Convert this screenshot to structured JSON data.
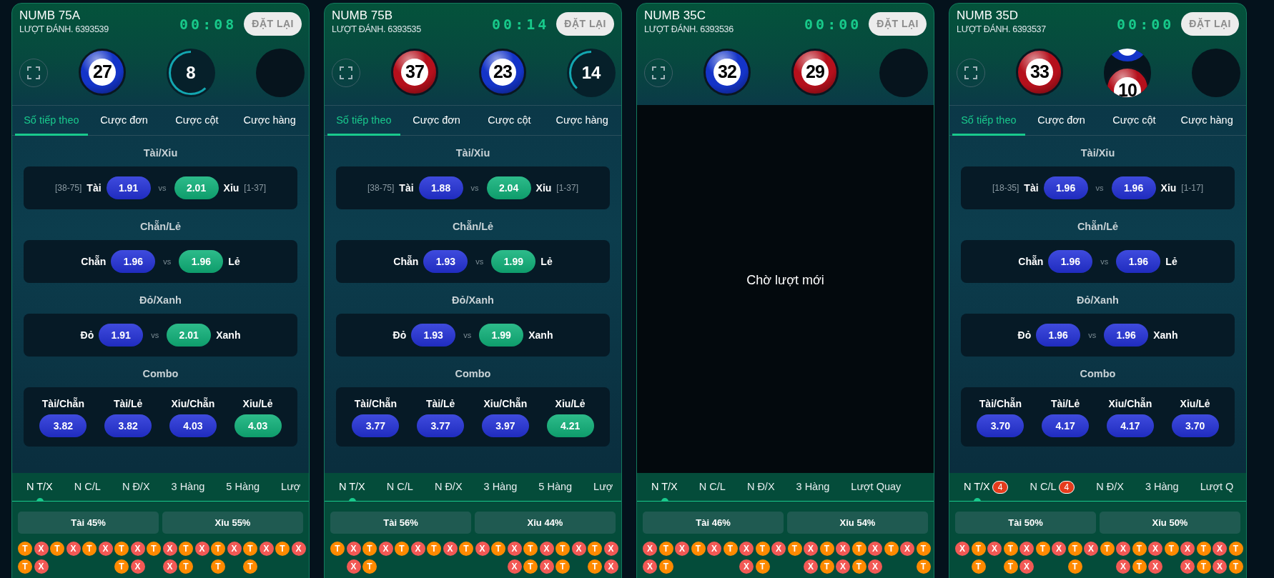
{
  "panels": [
    {
      "title": "NUMB 75A",
      "round": "LƯỢT ĐÁNH. 6393539",
      "timer": "00:08",
      "reset": "ĐẶT LẠI",
      "slots": [
        {
          "kind": "ball",
          "number": "27",
          "color": "#1434c8"
        },
        {
          "kind": "countdown",
          "number": "8",
          "level": 0.62
        },
        {
          "kind": "empty"
        }
      ],
      "tabs": [
        {
          "label": "Số tiếp theo",
          "selected": true
        },
        {
          "label": "Cược đơn",
          "selected": false
        },
        {
          "label": "Cược cột",
          "selected": false
        },
        {
          "label": "Cược hàng",
          "selected": false
        }
      ],
      "sections": [
        {
          "kind": "pair",
          "title": "Tài/Xỉu",
          "separator": "vs",
          "left": {
            "range": "[38-75]",
            "label": "Tài",
            "odds": "1.91",
            "color": "#2432d9"
          },
          "right": {
            "range": "[1-37]",
            "label": "Xỉu",
            "odds": "2.01",
            "color": "#10b27a"
          }
        },
        {
          "kind": "pair",
          "title": "Chẵn/Lẻ",
          "separator": "vs",
          "left": {
            "label": "Chẵn",
            "odds": "1.96",
            "color": "#2432d9"
          },
          "right": {
            "label": "Lẻ",
            "odds": "1.96",
            "color": "#10b27a"
          }
        },
        {
          "kind": "pair",
          "title": "Đỏ/Xanh",
          "separator": "vs",
          "left": {
            "label": "Đỏ",
            "odds": "1.91",
            "color": "#2432d9"
          },
          "right": {
            "label": "Xanh",
            "odds": "2.01",
            "color": "#10b27a"
          }
        },
        {
          "kind": "combo",
          "title": "Combo",
          "items": [
            {
              "label": "Tài/Chẵn",
              "odds": "3.82",
              "color": "#2432d9"
            },
            {
              "label": "Tài/Lẻ",
              "odds": "3.82",
              "color": "#2432d9"
            },
            {
              "label": "Xỉu/Chẵn",
              "odds": "4.03",
              "color": "#2432d9"
            },
            {
              "label": "Xỉu/Lẻ",
              "odds": "4.03",
              "color": "#10b27a"
            }
          ]
        }
      ],
      "history_tabs": [
        {
          "label": "N T/X",
          "selected": true
        },
        {
          "label": "N C/L",
          "selected": false
        },
        {
          "label": "N Đ/X",
          "selected": false
        },
        {
          "label": "3 Hàng",
          "selected": false
        },
        {
          "label": "5 Hàng",
          "selected": false
        },
        {
          "label": "Lượ",
          "selected": false
        }
      ],
      "stats": [
        "Tài 45%",
        "Xỉu 55%"
      ],
      "bead_columns": [
        [
          {
            "kind": "tai",
            "label": "T"
          },
          {
            "kind": "tai",
            "label": "T"
          }
        ],
        [
          {
            "kind": "xiu",
            "label": "X"
          },
          {
            "kind": "xiu",
            "label": "X"
          }
        ],
        [
          {
            "kind": "tai",
            "label": "T"
          }
        ],
        [
          {
            "kind": "xiu",
            "label": "X"
          }
        ],
        [
          {
            "kind": "tai",
            "label": "T"
          }
        ],
        [
          {
            "kind": "xiu",
            "label": "X"
          }
        ],
        [
          {
            "kind": "tai",
            "label": "T"
          },
          {
            "kind": "tai",
            "label": "T"
          }
        ],
        [
          {
            "kind": "xiu",
            "label": "X"
          },
          {
            "kind": "xiu",
            "label": "X"
          }
        ],
        [
          {
            "kind": "tai",
            "label": "T"
          }
        ],
        [
          {
            "kind": "xiu",
            "label": "X"
          },
          {
            "kind": "xiu",
            "label": "X"
          }
        ],
        [
          {
            "kind": "tai",
            "label": "T"
          },
          {
            "kind": "tai",
            "label": "T"
          }
        ],
        [
          {
            "kind": "xiu",
            "label": "X"
          }
        ],
        [
          {
            "kind": "tai",
            "label": "T"
          },
          {
            "kind": "tai",
            "label": "T"
          }
        ],
        [
          {
            "kind": "xiu",
            "label": "X"
          }
        ],
        [
          {
            "kind": "tai",
            "label": "T"
          },
          {
            "kind": "tai",
            "label": "T"
          }
        ],
        [
          {
            "kind": "xiu",
            "label": "X"
          }
        ],
        [
          {
            "kind": "tai",
            "label": "T"
          }
        ],
        [
          {
            "kind": "xiu",
            "label": "X"
          }
        ]
      ]
    },
    {
      "title": "NUMB 75B",
      "round": "LƯỢT ĐÁNH. 6393535",
      "timer": "00:14",
      "reset": "ĐẶT LẠI",
      "slots": [
        {
          "kind": "ball",
          "number": "37",
          "color": "#b5101c"
        },
        {
          "kind": "ball",
          "number": "23",
          "color": "#1434c8"
        },
        {
          "kind": "countdown",
          "number": "14",
          "level": 0.38
        }
      ],
      "tabs": [
        {
          "label": "Số tiếp theo",
          "selected": true
        },
        {
          "label": "Cược đơn",
          "selected": false
        },
        {
          "label": "Cược cột",
          "selected": false
        },
        {
          "label": "Cược hàng",
          "selected": false
        }
      ],
      "sections": [
        {
          "kind": "pair",
          "title": "Tài/Xỉu",
          "separator": "vs",
          "left": {
            "range": "[38-75]",
            "label": "Tài",
            "odds": "1.88",
            "color": "#2432d9"
          },
          "right": {
            "range": "[1-37]",
            "label": "Xỉu",
            "odds": "2.04",
            "color": "#10b27a"
          }
        },
        {
          "kind": "pair",
          "title": "Chẵn/Lẻ",
          "separator": "vs",
          "left": {
            "label": "Chẵn",
            "odds": "1.93",
            "color": "#2432d9"
          },
          "right": {
            "label": "Lẻ",
            "odds": "1.99",
            "color": "#10b27a"
          }
        },
        {
          "kind": "pair",
          "title": "Đỏ/Xanh",
          "separator": "vs",
          "left": {
            "label": "Đỏ",
            "odds": "1.93",
            "color": "#2432d9"
          },
          "right": {
            "label": "Xanh",
            "odds": "1.99",
            "color": "#10b27a"
          }
        },
        {
          "kind": "combo",
          "title": "Combo",
          "items": [
            {
              "label": "Tài/Chẵn",
              "odds": "3.77",
              "color": "#2432d9"
            },
            {
              "label": "Tài/Lẻ",
              "odds": "3.77",
              "color": "#2432d9"
            },
            {
              "label": "Xỉu/Chẵn",
              "odds": "3.97",
              "color": "#2432d9"
            },
            {
              "label": "Xỉu/Lẻ",
              "odds": "4.21",
              "color": "#10b27a"
            }
          ]
        }
      ],
      "history_tabs": [
        {
          "label": "N T/X",
          "selected": true
        },
        {
          "label": "N C/L",
          "selected": false
        },
        {
          "label": "N Đ/X",
          "selected": false
        },
        {
          "label": "3 Hàng",
          "selected": false
        },
        {
          "label": "5 Hàng",
          "selected": false
        },
        {
          "label": "Lượ",
          "selected": false
        }
      ],
      "stats": [
        "Tài 56%",
        "Xỉu 44%"
      ],
      "bead_columns": [
        [
          {
            "kind": "tai",
            "label": "T"
          }
        ],
        [
          {
            "kind": "xiu",
            "label": "X"
          },
          {
            "kind": "xiu",
            "label": "X"
          }
        ],
        [
          {
            "kind": "tai",
            "label": "T"
          },
          {
            "kind": "tai",
            "label": "T"
          }
        ],
        [
          {
            "kind": "xiu",
            "label": "X"
          }
        ],
        [
          {
            "kind": "tai",
            "label": "T"
          }
        ],
        [
          {
            "kind": "xiu",
            "label": "X"
          }
        ],
        [
          {
            "kind": "tai",
            "label": "T"
          }
        ],
        [
          {
            "kind": "xiu",
            "label": "X"
          }
        ],
        [
          {
            "kind": "tai",
            "label": "T"
          }
        ],
        [
          {
            "kind": "xiu",
            "label": "X"
          }
        ],
        [
          {
            "kind": "tai",
            "label": "T"
          }
        ],
        [
          {
            "kind": "xiu",
            "label": "X"
          },
          {
            "kind": "xiu",
            "label": "X"
          }
        ],
        [
          {
            "kind": "tai",
            "label": "T"
          },
          {
            "kind": "tai",
            "label": "T"
          }
        ],
        [
          {
            "kind": "xiu",
            "label": "X"
          },
          {
            "kind": "xiu",
            "label": "X"
          }
        ],
        [
          {
            "kind": "tai",
            "label": "T"
          },
          {
            "kind": "tai",
            "label": "T"
          }
        ],
        [
          {
            "kind": "xiu",
            "label": "X"
          }
        ],
        [
          {
            "kind": "tai",
            "label": "T"
          },
          {
            "kind": "tai",
            "label": "T"
          }
        ],
        [
          {
            "kind": "xiu",
            "label": "X"
          },
          {
            "kind": "xiu",
            "label": "X"
          }
        ]
      ]
    },
    {
      "title": "NUMB 35C",
      "round": "LƯỢT ĐÁNH. 6393536",
      "timer": "00:00",
      "reset": "ĐẶT LẠI",
      "slots": [
        {
          "kind": "ball",
          "number": "32",
          "color": "#1434c8"
        },
        {
          "kind": "ball",
          "number": "29",
          "color": "#b5101c"
        },
        {
          "kind": "empty"
        }
      ],
      "overlay": {
        "message": "Chờ lượt mới"
      },
      "history_tabs": [
        {
          "label": "N T/X",
          "selected": true
        },
        {
          "label": "N C/L",
          "selected": false
        },
        {
          "label": "N Đ/X",
          "selected": false
        },
        {
          "label": "3 Hàng",
          "selected": false
        },
        {
          "label": "Lượt Quay",
          "selected": false
        }
      ],
      "stats": [
        "Tài 46%",
        "Xỉu 54%"
      ],
      "bead_columns": [
        [
          {
            "kind": "xiu",
            "label": "X"
          },
          {
            "kind": "xiu",
            "label": "X"
          }
        ],
        [
          {
            "kind": "tai",
            "label": "T"
          },
          {
            "kind": "tai",
            "label": "T"
          }
        ],
        [
          {
            "kind": "xiu",
            "label": "X"
          }
        ],
        [
          {
            "kind": "tai",
            "label": "T"
          }
        ],
        [
          {
            "kind": "xiu",
            "label": "X"
          }
        ],
        [
          {
            "kind": "tai",
            "label": "T"
          }
        ],
        [
          {
            "kind": "xiu",
            "label": "X"
          },
          {
            "kind": "xiu",
            "label": "X"
          }
        ],
        [
          {
            "kind": "tai",
            "label": "T"
          },
          {
            "kind": "tai",
            "label": "T"
          }
        ],
        [
          {
            "kind": "xiu",
            "label": "X"
          }
        ],
        [
          {
            "kind": "tai",
            "label": "T"
          }
        ],
        [
          {
            "kind": "xiu",
            "label": "X"
          },
          {
            "kind": "xiu",
            "label": "X"
          }
        ],
        [
          {
            "kind": "tai",
            "label": "T"
          },
          {
            "kind": "tai",
            "label": "T"
          }
        ],
        [
          {
            "kind": "xiu",
            "label": "X"
          },
          {
            "kind": "xiu",
            "label": "X"
          }
        ],
        [
          {
            "kind": "tai",
            "label": "T"
          },
          {
            "kind": "tai",
            "label": "T"
          }
        ],
        [
          {
            "kind": "xiu",
            "label": "X"
          },
          {
            "kind": "xiu",
            "label": "X"
          }
        ],
        [
          {
            "kind": "tai",
            "label": "T"
          }
        ],
        [
          {
            "kind": "xiu",
            "label": "X"
          }
        ],
        [
          {
            "kind": "tai",
            "label": "T"
          },
          {
            "kind": "tai",
            "label": "T"
          }
        ]
      ]
    },
    {
      "title": "NUMB 35D",
      "round": "LƯỢT ĐÁNH. 6393537",
      "timer": "00:00",
      "reset": "ĐẶT LẠI",
      "slots": [
        {
          "kind": "ball",
          "number": "33",
          "color": "#b5101c"
        },
        {
          "kind": "rolling",
          "balls": [
            {
              "color": "#1434c8"
            },
            {
              "number": "10",
              "color": "#b5101c"
            }
          ]
        },
        {
          "kind": "empty"
        }
      ],
      "tabs": [
        {
          "label": "Số tiếp theo",
          "selected": true
        },
        {
          "label": "Cược đơn",
          "selected": false
        },
        {
          "label": "Cược cột",
          "selected": false
        },
        {
          "label": "Cược hàng",
          "selected": false
        }
      ],
      "sections": [
        {
          "kind": "pair",
          "title": "Tài/Xỉu",
          "separator": "vs",
          "left": {
            "range": "[18-35]",
            "label": "Tài",
            "odds": "1.96",
            "color": "#2432d9"
          },
          "right": {
            "range": "[1-17]",
            "label": "Xỉu",
            "odds": "1.96",
            "color": "#2432d9"
          }
        },
        {
          "kind": "pair",
          "title": "Chẵn/Lẻ",
          "separator": "vs",
          "left": {
            "label": "Chẵn",
            "odds": "1.96",
            "color": "#2432d9"
          },
          "right": {
            "label": "Lẻ",
            "odds": "1.96",
            "color": "#2432d9"
          }
        },
        {
          "kind": "pair",
          "title": "Đỏ/Xanh",
          "separator": "vs",
          "left": {
            "label": "Đỏ",
            "odds": "1.96",
            "color": "#2432d9"
          },
          "right": {
            "label": "Xanh",
            "odds": "1.96",
            "color": "#2432d9"
          }
        },
        {
          "kind": "combo",
          "title": "Combo",
          "items": [
            {
              "label": "Tài/Chẵn",
              "odds": "3.70",
              "color": "#2432d9"
            },
            {
              "label": "Tài/Lẻ",
              "odds": "4.17",
              "color": "#2432d9"
            },
            {
              "label": "Xỉu/Chẵn",
              "odds": "4.17",
              "color": "#2432d9"
            },
            {
              "label": "Xỉu/Lẻ",
              "odds": "3.70",
              "color": "#2432d9"
            }
          ]
        }
      ],
      "history_tabs": [
        {
          "label": "N T/X",
          "selected": true,
          "badge": "4"
        },
        {
          "label": "N C/L",
          "selected": false,
          "badge": "4"
        },
        {
          "label": "N Đ/X",
          "selected": false
        },
        {
          "label": "3 Hàng",
          "selected": false
        },
        {
          "label": "Lượt Q",
          "selected": false
        }
      ],
      "stats": [
        "Tài 50%",
        "Xỉu 50%"
      ],
      "bead_columns": [
        [
          {
            "kind": "xiu",
            "label": "X"
          }
        ],
        [
          {
            "kind": "tai",
            "label": "T"
          },
          {
            "kind": "tai",
            "label": "T"
          }
        ],
        [
          {
            "kind": "xiu",
            "label": "X"
          }
        ],
        [
          {
            "kind": "tai",
            "label": "T"
          },
          {
            "kind": "tai",
            "label": "T"
          }
        ],
        [
          {
            "kind": "xiu",
            "label": "X"
          },
          {
            "kind": "xiu",
            "label": "X"
          }
        ],
        [
          {
            "kind": "tai",
            "label": "T"
          }
        ],
        [
          {
            "kind": "xiu",
            "label": "X"
          }
        ],
        [
          {
            "kind": "tai",
            "label": "T"
          },
          {
            "kind": "tai",
            "label": "T"
          }
        ],
        [
          {
            "kind": "xiu",
            "label": "X"
          }
        ],
        [
          {
            "kind": "tai",
            "label": "T"
          }
        ],
        [
          {
            "kind": "xiu",
            "label": "X"
          },
          {
            "kind": "xiu",
            "label": "X"
          }
        ],
        [
          {
            "kind": "tai",
            "label": "T"
          },
          {
            "kind": "tai",
            "label": "T"
          }
        ],
        [
          {
            "kind": "xiu",
            "label": "X"
          },
          {
            "kind": "xiu",
            "label": "X"
          }
        ],
        [
          {
            "kind": "tai",
            "label": "T"
          }
        ],
        [
          {
            "kind": "xiu",
            "label": "X"
          },
          {
            "kind": "xiu",
            "label": "X"
          }
        ],
        [
          {
            "kind": "tai",
            "label": "T"
          },
          {
            "kind": "tai",
            "label": "T"
          }
        ],
        [
          {
            "kind": "xiu",
            "label": "X"
          },
          {
            "kind": "xiu",
            "label": "X"
          }
        ],
        [
          {
            "kind": "tai",
            "label": "T"
          },
          {
            "kind": "tai",
            "label": "T"
          }
        ]
      ]
    }
  ]
}
